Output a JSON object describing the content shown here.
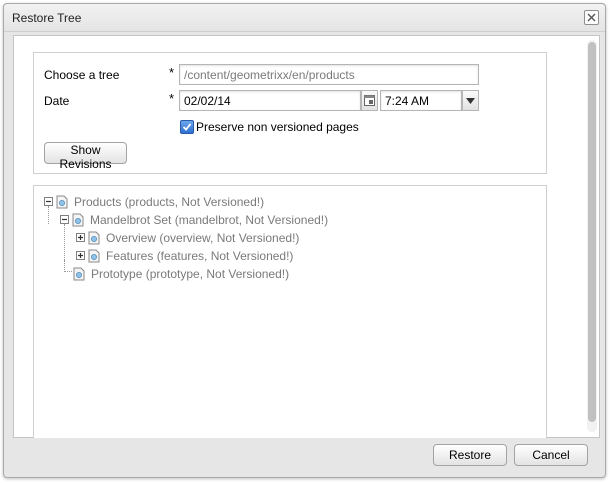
{
  "dialog": {
    "title": "Restore Tree"
  },
  "form": {
    "tree_label": "Choose a tree",
    "tree_value": "/content/geometrixx/en/products",
    "required_marker": "*",
    "date_label": "Date",
    "date_value": "02/02/14",
    "time_value": "7:24 AM",
    "preserve_label": "Preserve non versioned pages",
    "preserve_checked": true,
    "show_revisions_label": "Show Revisions"
  },
  "tree": [
    {
      "label": "Products (products, Not Versioned!)",
      "toggle": "collapse"
    },
    {
      "label": "Mandelbrot Set (mandelbrot, Not Versioned!)",
      "toggle": "collapse"
    },
    {
      "label": "Overview (overview, Not Versioned!)",
      "toggle": "expand"
    },
    {
      "label": "Features (features, Not Versioned!)",
      "toggle": "expand"
    },
    {
      "label": "Prototype (prototype, Not Versioned!)",
      "toggle": "none"
    }
  ],
  "footer": {
    "restore_label": "Restore",
    "cancel_label": "Cancel"
  }
}
